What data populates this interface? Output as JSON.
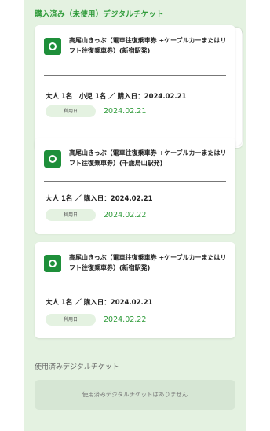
{
  "purchased_section": {
    "title": "購入済み（未使用）デジタルチケット"
  },
  "tickets": [
    {
      "name": "高尾山きっぷ（電車往復乗車券 +ケーブルカーまたはリフト往復乗車券）(新宿駅発)",
      "summary": "大人 1名　小児 1名 ／ 購入日：2024.02.21",
      "use_label": "利用日",
      "use_date": "2024.02.21",
      "icon": "ticket-icon"
    },
    {
      "name": "高尾山きっぷ（電車往復乗車券 +ケーブルカーまたはリフト往復乗車券）(千歳烏山駅発)",
      "summary": "大人 1名 ／ 購入日：2024.02.21",
      "use_label": "利用日",
      "use_date": "2024.02.22",
      "icon": "ticket-icon"
    },
    {
      "name": "高尾山きっぷ（電車往復乗車券 +ケーブルカーまたはリフト往復乗車券）(新宿駅発)",
      "summary": "大人 1名 ／ 購入日：2024.02.21",
      "use_label": "利用日",
      "use_date": "2024.02.22",
      "icon": "ticket-icon"
    }
  ],
  "used_section": {
    "title": "使用済みデジタルチケット",
    "empty_message": "使用済みデジタルチケットはありません"
  },
  "colors": {
    "accent": "#2f9b3a",
    "icon_bg": "#1e8f3a",
    "panel_bg": "#e4f2e1"
  }
}
